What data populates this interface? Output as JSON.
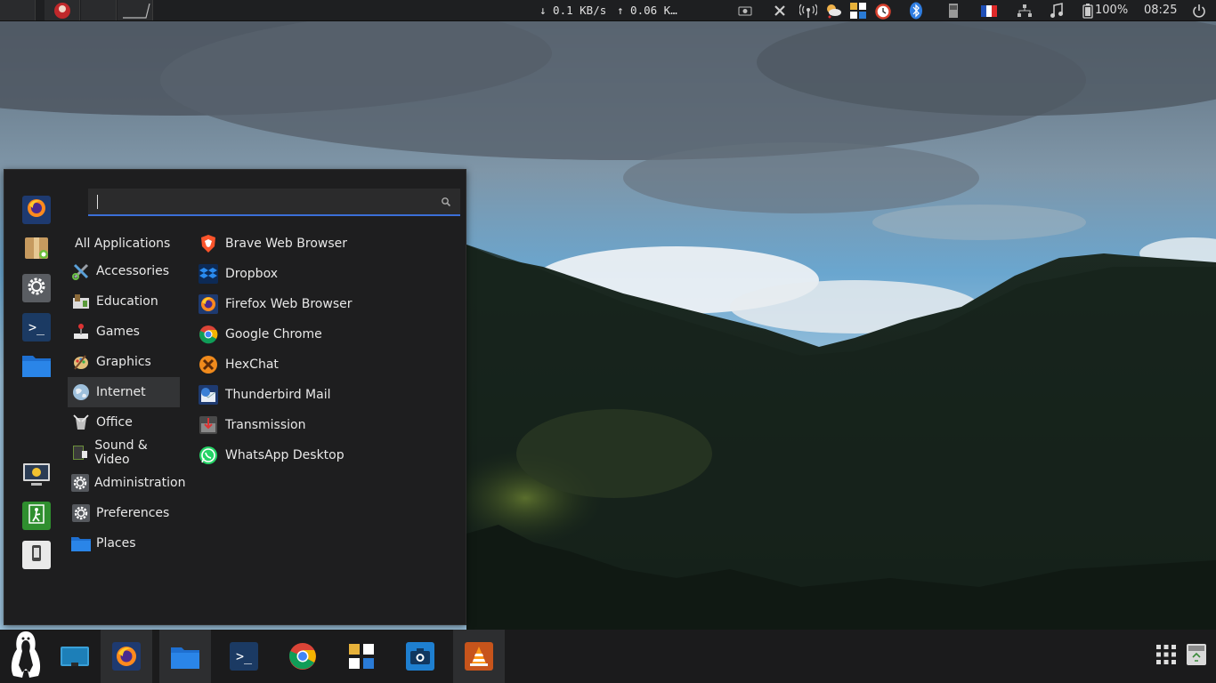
{
  "top_panel": {
    "net_down": "↓ 0.1 KB/s",
    "net_up": "↑ 0.06 K…",
    "battery": "100%",
    "clock": "08:25",
    "tray_icons": [
      "camera-icon",
      "close-x-icon",
      "wifi-antenna-icon",
      "weather-icon",
      "ob-icon",
      "alarm-clock-icon",
      "bluetooth-icon",
      "storage-icon",
      "french-flag-icon",
      "network-icon",
      "music-note-icon",
      "battery-icon",
      "power-icon"
    ]
  },
  "menu": {
    "search": {
      "value": "",
      "placeholder": ""
    },
    "favorites": [
      "firefox-icon",
      "package-installer-icon",
      "settings-icon",
      "terminal-icon",
      "folder-icon",
      "screen-lock-icon",
      "logout-icon",
      "phone-icon"
    ],
    "categories": [
      {
        "label": "All Applications",
        "icon": ""
      },
      {
        "label": "Accessories",
        "icon": "accessories-icon"
      },
      {
        "label": "Education",
        "icon": "education-icon"
      },
      {
        "label": "Games",
        "icon": "games-icon"
      },
      {
        "label": "Graphics",
        "icon": "graphics-icon"
      },
      {
        "label": "Internet",
        "icon": "internet-globe-icon"
      },
      {
        "label": "Office",
        "icon": "office-icon"
      },
      {
        "label": "Sound & Video",
        "icon": "sound-video-icon"
      },
      {
        "label": "Administration",
        "icon": "administration-gear-icon"
      },
      {
        "label": "Preferences",
        "icon": "preferences-gear-icon"
      },
      {
        "label": "Places",
        "icon": "places-folder-icon"
      }
    ],
    "selected_category": "Internet",
    "apps": [
      {
        "label": "Brave Web Browser",
        "icon": "brave-icon"
      },
      {
        "label": "Dropbox",
        "icon": "dropbox-icon"
      },
      {
        "label": "Firefox Web Browser",
        "icon": "firefox-icon"
      },
      {
        "label": "Google Chrome",
        "icon": "chrome-icon"
      },
      {
        "label": "HexChat",
        "icon": "hexchat-icon"
      },
      {
        "label": "Thunderbird Mail",
        "icon": "thunderbird-icon"
      },
      {
        "label": "Transmission",
        "icon": "transmission-icon"
      },
      {
        "label": "WhatsApp Desktop",
        "icon": "whatsapp-icon"
      }
    ]
  },
  "taskbar": {
    "items": [
      "menu-penguin-icon",
      "show-desktop-icon",
      "firefox-icon",
      "file-manager-icon",
      "terminal-icon",
      "chrome-icon",
      "ob-icon",
      "screenshot-camera-icon",
      "vlc-icon"
    ],
    "tray": [
      "app-grid-icon",
      "trash-icon"
    ]
  },
  "colors": {
    "panel_bg": "#1e1f21",
    "menu_bg": "#1e1e1f",
    "accent": "#3b6fd8",
    "selected_bg": "#333436"
  }
}
